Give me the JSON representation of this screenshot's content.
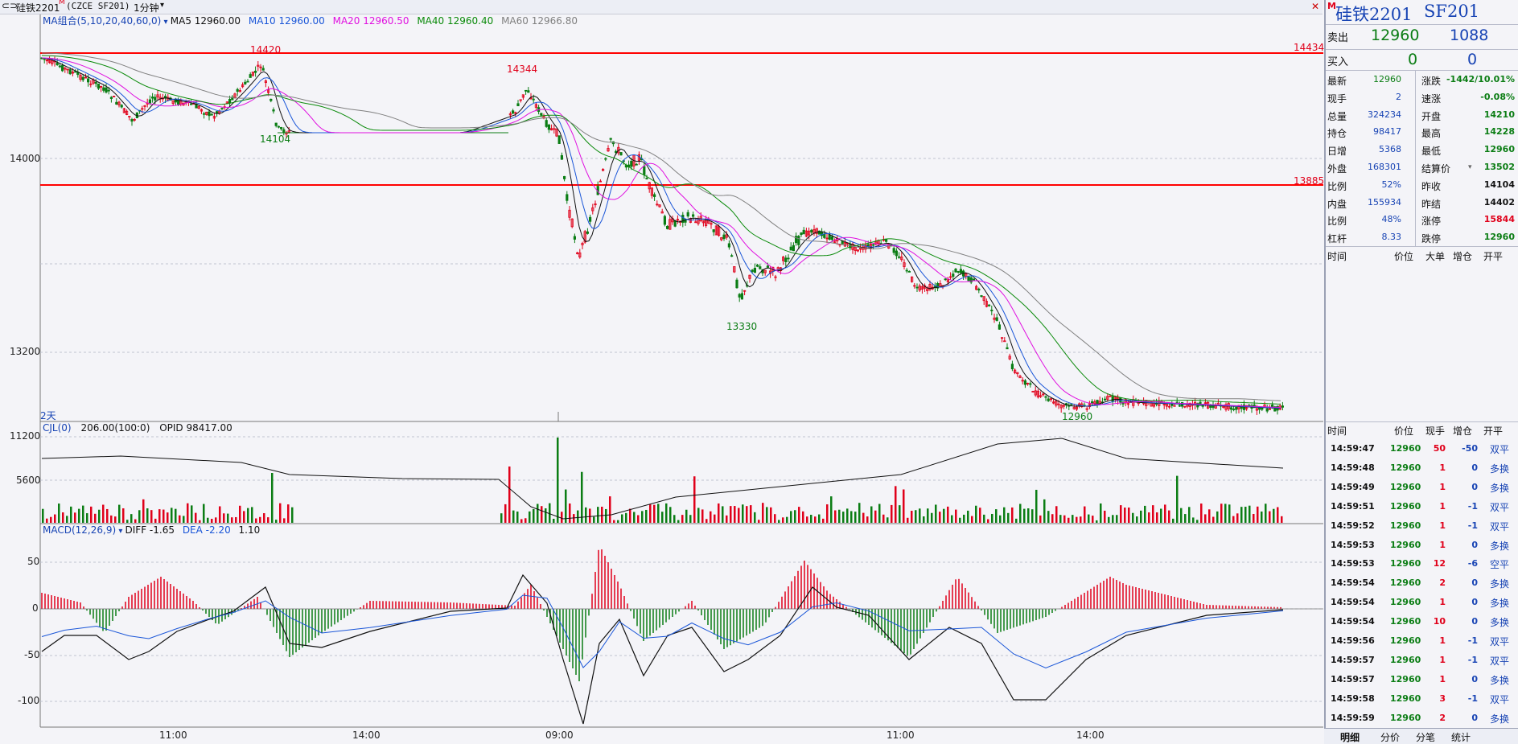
{
  "topbar": {
    "instrument": "硅铁2201",
    "marker": "M",
    "code": "(CZCE SF201)",
    "period": "1分钟"
  },
  "ma_legend": {
    "name": "MA组合(5,10,20,40,60,0)",
    "ma5": "MA5 12960.00",
    "ma10": "MA10 12960.00",
    "ma20": "MA20 12960.50",
    "ma40": "MA40 12960.40",
    "ma60": "MA60 12966.80"
  },
  "vol_legend": {
    "name": "CJL(0)",
    "values": "206.00(100:0)",
    "opid": "OPID 98417.00"
  },
  "macd_legend": {
    "name": "MACD(12,26,9)",
    "diff": "DIFF -1.65",
    "dea": "DEA -2.20",
    "macd": "1.10"
  },
  "axis": {
    "price_ticks": [
      "14000",
      "13200"
    ],
    "vol_ticks": [
      "11200",
      "5600"
    ],
    "macd_ticks": [
      "50",
      "0",
      "-50",
      "-100"
    ],
    "time_ticks": [
      "11:00",
      "14:00",
      "09:00",
      "11:00",
      "14:00"
    ],
    "days": "2天"
  },
  "annotations": {
    "high1": "14420",
    "low1": "14104",
    "high2": "14344",
    "low2": "13330",
    "last": "12960",
    "line1": "14434",
    "line2": "13885"
  },
  "colors": {
    "up": "#e0001a",
    "down": "#0b7d14",
    "ma5": "#111111",
    "ma10": "#1a56d8",
    "ma20": "#e010e0",
    "ma40": "#0a8a0a",
    "ma60": "#808080",
    "hline": "#ff0000"
  },
  "quote": {
    "title": "硅铁2201",
    "code": "SF201",
    "title_marker": "M",
    "sell_label": "卖出",
    "sell_price": "12960",
    "sell_vol": "1088",
    "buy_label": "买入",
    "buy_price": "0",
    "buy_vol": "0",
    "stats": [
      {
        "l": "最新",
        "v": "12960",
        "l2": "涨跌",
        "v2": "-1442/10.01%"
      },
      {
        "l": "现手",
        "v": "2",
        "l2": "速涨",
        "v2": "-0.08%"
      },
      {
        "l": "总量",
        "v": "324234",
        "l2": "开盘",
        "v2": "14210"
      },
      {
        "l": "持仓",
        "v": "98417",
        "l2": "最高",
        "v2": "14228"
      },
      {
        "l": "日增",
        "v": "5368",
        "l2": "最低",
        "v2": "12960"
      },
      {
        "l": "外盘",
        "v": "168301",
        "l2": "结算价",
        "v2": "13502"
      },
      {
        "l": "比例",
        "v": "52%",
        "l2": "昨收",
        "v2": "14104"
      },
      {
        "l": "内盘",
        "v": "155934",
        "l2": "昨结",
        "v2": "14402"
      },
      {
        "l": "比例",
        "v": "48%",
        "l2": "涨停",
        "v2": "15844"
      },
      {
        "l": "杠杆",
        "v": "8.33",
        "l2": "跌停",
        "v2": "12960"
      }
    ],
    "price_table_header": [
      "时间",
      "价位",
      "大单",
      "增仓",
      "开平"
    ],
    "ticks_header": [
      "时间",
      "价位",
      "现手",
      "增仓",
      "开平"
    ],
    "ticks": [
      {
        "t": "14:59:47",
        "p": "12960",
        "v": "50",
        "d": "-50",
        "k": "双平"
      },
      {
        "t": "14:59:48",
        "p": "12960",
        "v": "1",
        "d": "0",
        "k": "多换"
      },
      {
        "t": "14:59:49",
        "p": "12960",
        "v": "1",
        "d": "0",
        "k": "多换"
      },
      {
        "t": "14:59:51",
        "p": "12960",
        "v": "1",
        "d": "-1",
        "k": "双平"
      },
      {
        "t": "14:59:52",
        "p": "12960",
        "v": "1",
        "d": "-1",
        "k": "双平"
      },
      {
        "t": "14:59:53",
        "p": "12960",
        "v": "1",
        "d": "0",
        "k": "多换"
      },
      {
        "t": "14:59:53",
        "p": "12960",
        "v": "12",
        "d": "-6",
        "k": "空平"
      },
      {
        "t": "14:59:54",
        "p": "12960",
        "v": "2",
        "d": "0",
        "k": "多换"
      },
      {
        "t": "14:59:54",
        "p": "12960",
        "v": "1",
        "d": "0",
        "k": "多换"
      },
      {
        "t": "14:59:54",
        "p": "12960",
        "v": "10",
        "d": "0",
        "k": "多换"
      },
      {
        "t": "14:59:56",
        "p": "12960",
        "v": "1",
        "d": "-1",
        "k": "双平"
      },
      {
        "t": "14:59:57",
        "p": "12960",
        "v": "1",
        "d": "-1",
        "k": "双平"
      },
      {
        "t": "14:59:57",
        "p": "12960",
        "v": "1",
        "d": "0",
        "k": "多换"
      },
      {
        "t": "14:59:58",
        "p": "12960",
        "v": "3",
        "d": "-1",
        "k": "双平"
      },
      {
        "t": "14:59:59",
        "p": "12960",
        "v": "2",
        "d": "0",
        "k": "多换"
      }
    ],
    "tabs": [
      "明细",
      "分价",
      "分笔",
      "统计"
    ]
  }
}
